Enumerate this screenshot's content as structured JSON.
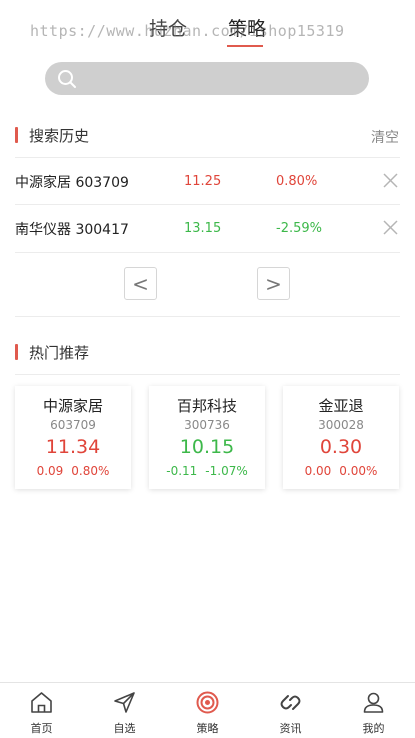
{
  "header": {
    "tabs": [
      {
        "label": "持仓"
      },
      {
        "label": "策略"
      }
    ],
    "watermark": "https://www.huzhan.com/ishop15319"
  },
  "search": {
    "placeholder": ""
  },
  "history": {
    "title": "搜索历史",
    "clear_label": "清空",
    "items": [
      {
        "name": "中源家居 603709",
        "price": "11.25",
        "change_pct": "0.80%"
      },
      {
        "name": "南华仪器 300417",
        "price": "13.15",
        "change_pct": "-2.59%"
      }
    ],
    "prev_label": "<",
    "next_label": ">"
  },
  "hot": {
    "title": "热门推荐",
    "cards": [
      {
        "name": "中源家居",
        "code": "603709",
        "price": "11.34",
        "change": "0.09",
        "change_pct": "0.80%"
      },
      {
        "name": "百邦科技",
        "code": "300736",
        "price": "10.15",
        "change": "-0.11",
        "change_pct": "-1.07%"
      },
      {
        "name": "金亚退",
        "code": "300028",
        "price": "0.30",
        "change": "0.00",
        "change_pct": "0.00%"
      }
    ]
  },
  "bottom_nav": {
    "items": [
      {
        "label": "首页",
        "icon": "home-icon"
      },
      {
        "label": "自选",
        "icon": "send-icon"
      },
      {
        "label": "策略",
        "icon": "target-icon"
      },
      {
        "label": "资讯",
        "icon": "link-icon"
      },
      {
        "label": "我的",
        "icon": "user-icon"
      }
    ]
  },
  "colors": {
    "accent": "#e05a4e",
    "up": "#e0453a",
    "down": "#3db84a"
  }
}
